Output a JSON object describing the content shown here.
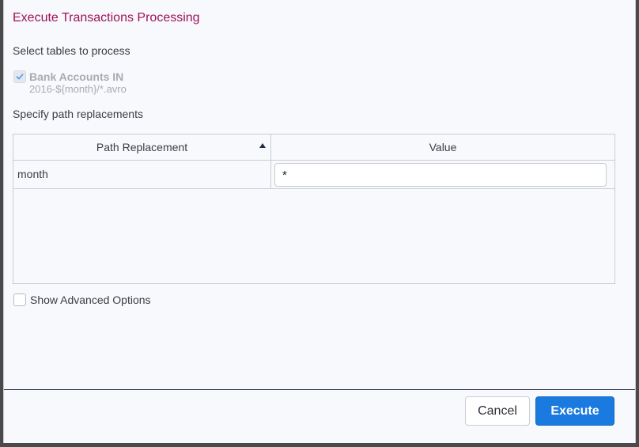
{
  "dialog": {
    "title": "Execute Transactions Processing"
  },
  "tables_section": {
    "label": "Select tables to process",
    "items": [
      {
        "name": "Bank Accounts IN",
        "path": "2016-${month}/*.avro",
        "checked": true,
        "disabled": true
      }
    ]
  },
  "paths_section": {
    "label": "Specify path replacements",
    "columns": {
      "path": "Path Replacement",
      "value": "Value"
    },
    "sort": "ascending",
    "rows": [
      {
        "key": "month",
        "value": "*"
      }
    ]
  },
  "advanced": {
    "label": "Show Advanced Options",
    "checked": false
  },
  "footer": {
    "cancel_label": "Cancel",
    "execute_label": "Execute"
  },
  "colors": {
    "title": "#a0105a",
    "primary": "#1a7ae0",
    "divider": "#1f2a44"
  },
  "icons": {
    "table_checkbox": "check-icon",
    "sort": "sort-ascending-icon"
  }
}
